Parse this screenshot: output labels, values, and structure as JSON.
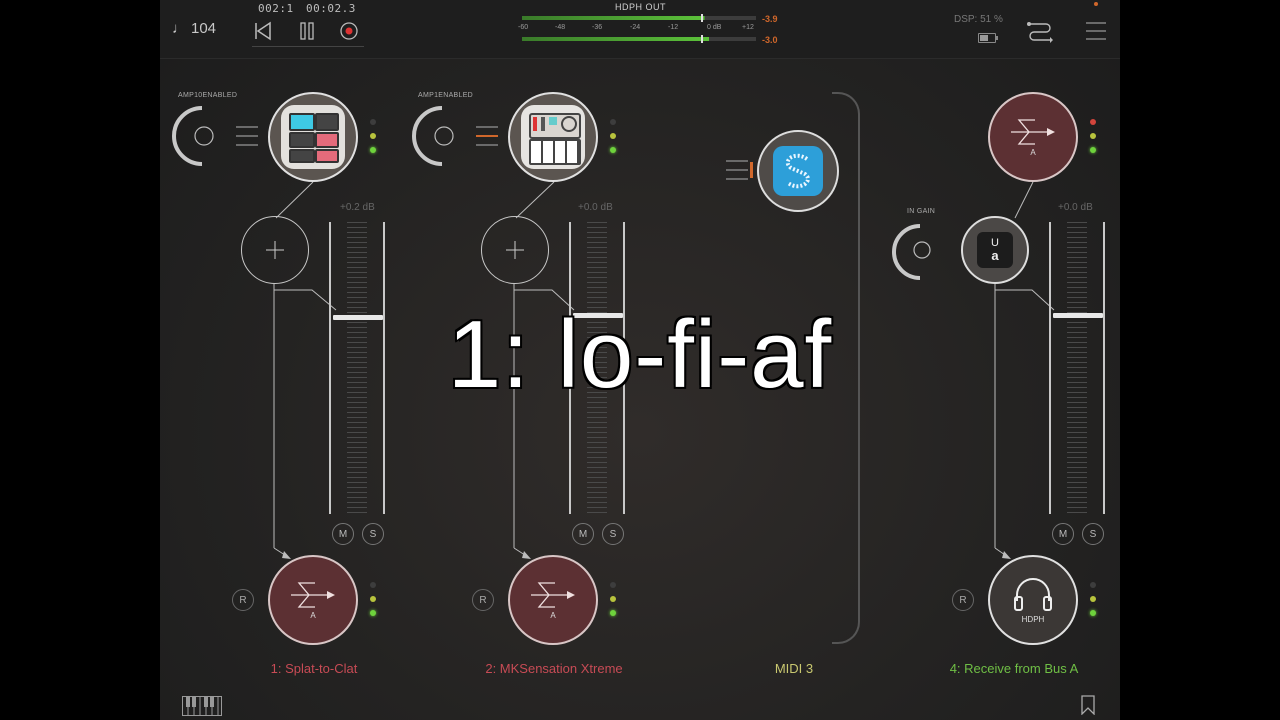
{
  "topbar": {
    "tempo": "104",
    "position_bars": "002:1",
    "position_time": "00:02.3",
    "meter_title": "HDPH OUT",
    "meter_scale": [
      "-60",
      "-48",
      "-36",
      "-24",
      "-12",
      "0 dB",
      "+12"
    ],
    "peak_top": "-3.9",
    "peak_bottom": "-3.0",
    "dsp": "DSP: 51 %",
    "battery_level": 0.6
  },
  "channels": [
    {
      "knob_label": "AMP10ENABLED",
      "db": "+0.2 dB",
      "mute": "M",
      "solo": "S",
      "rec": "R",
      "bus_label": "A",
      "name": "1: Splat-to-Clat",
      "name_color": "#c74b55",
      "fader_level": 0.32
    },
    {
      "knob_label": "AMP1ENABLED",
      "db": "+0.0 dB",
      "mute": "M",
      "solo": "S",
      "rec": "R",
      "bus_label": "A",
      "name": "2: MKSensation Xtreme",
      "name_color": "#c74b55",
      "fader_level": 0.31
    },
    {
      "name": "MIDI 3",
      "name_color": "#c9c870"
    },
    {
      "knob_label": "IN GAIN",
      "db": "+0.0 dB",
      "mute": "M",
      "solo": "S",
      "rec": "R",
      "bus_label": "A",
      "output_label": "HDPH",
      "name": "4: Receive from Bus A",
      "name_color": "#6fbf45",
      "fader_level": 0.31
    }
  ],
  "overlay_text": "1: lo-fi-af",
  "colors": {
    "bus": "#5c3033",
    "accent_orange": "#d0672b",
    "green": "#6ed23c"
  }
}
